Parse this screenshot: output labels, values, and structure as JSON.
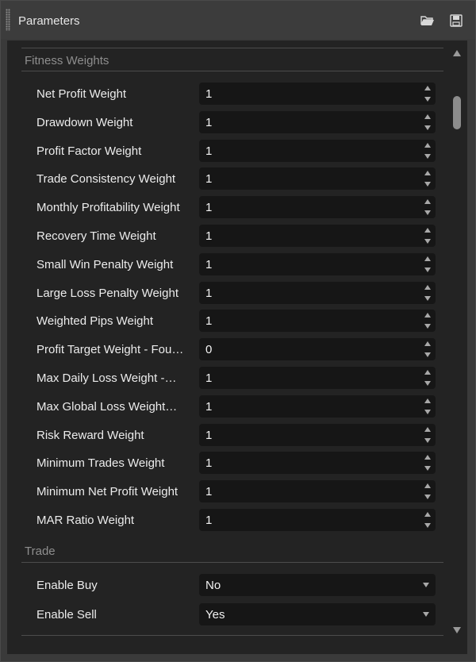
{
  "panel": {
    "title": "Parameters",
    "open_icon": "folder-open-icon",
    "save_icon": "save-icon"
  },
  "sections": [
    {
      "title": "Fitness Weights",
      "rows": [
        {
          "label": "Net Profit Weight",
          "value": "1"
        },
        {
          "label": "Drawdown Weight",
          "value": "1"
        },
        {
          "label": "Profit Factor Weight",
          "value": "1"
        },
        {
          "label": "Trade Consistency Weight",
          "value": "1"
        },
        {
          "label": "Monthly Profitability Weight",
          "value": "1"
        },
        {
          "label": "Recovery Time Weight",
          "value": "1"
        },
        {
          "label": "Small Win Penalty Weight",
          "value": "1"
        },
        {
          "label": "Large Loss Penalty Weight",
          "value": "1"
        },
        {
          "label": "Weighted Pips Weight",
          "value": "1"
        },
        {
          "label": "Profit Target Weight - Fou…",
          "value": "0"
        },
        {
          "label": "Max Daily Loss Weight -…",
          "value": "1"
        },
        {
          "label": "Max Global Loss Weight…",
          "value": "1"
        },
        {
          "label": "Risk Reward Weight",
          "value": "1"
        },
        {
          "label": "Minimum Trades Weight",
          "value": "1"
        },
        {
          "label": "Minimum Net Profit Weight",
          "value": "1"
        },
        {
          "label": "MAR Ratio Weight",
          "value": "1"
        }
      ]
    },
    {
      "title": "Trade",
      "rows": [
        {
          "label": "Enable Buy",
          "value": "No"
        },
        {
          "label": "Enable Sell",
          "value": "Yes"
        }
      ]
    }
  ]
}
